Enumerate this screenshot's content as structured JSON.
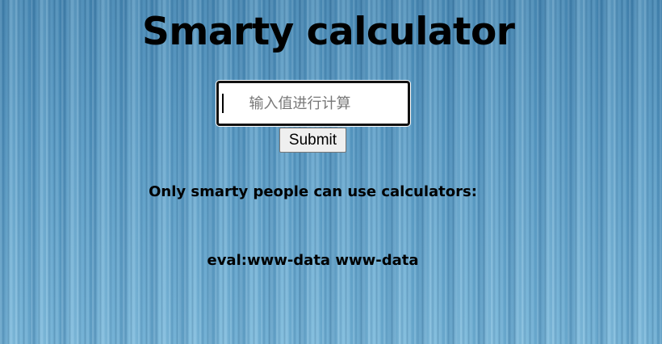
{
  "page": {
    "title": "Smarty calculator"
  },
  "form": {
    "input_placeholder": "输入值进行计算",
    "input_value": "",
    "submit_label": "Submit"
  },
  "content": {
    "subtitle": "Only smarty people can use calculators:",
    "result": "eval:www-data www-data"
  }
}
